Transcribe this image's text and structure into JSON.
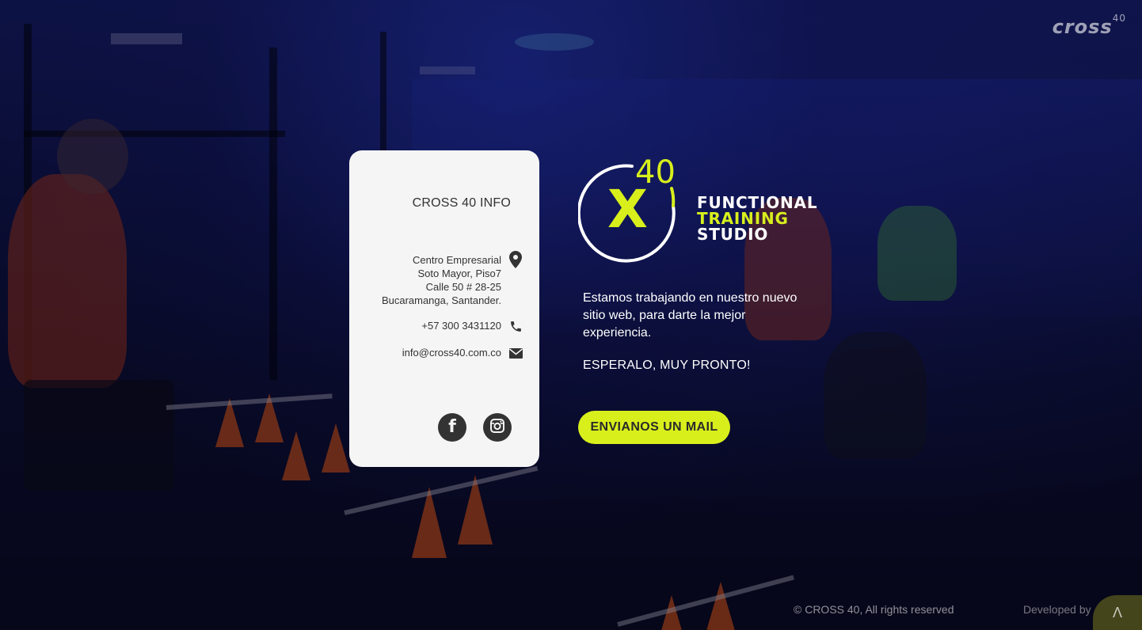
{
  "brand": {
    "name": "cross",
    "superscript": "40"
  },
  "info_card": {
    "title": "CROSS 40 INFO",
    "address": {
      "lines": [
        "Centro Empresarial",
        "Soto Mayor, Piso7",
        "Calle 50 # 28-25",
        "Bucaramanga, Santander."
      ],
      "icon": "location-pin-icon"
    },
    "phone": {
      "text": "+57 300 3431120",
      "icon": "phone-icon"
    },
    "email": {
      "text": "info@cross40.com.co",
      "icon": "mail-icon"
    },
    "social": [
      {
        "name": "facebook",
        "icon": "facebook-icon"
      },
      {
        "name": "instagram",
        "icon": "instagram-icon"
      }
    ]
  },
  "logo": {
    "mark_letter": "X",
    "mark_number": "40",
    "line1": "FUNCTIONAL",
    "line2": "TRAINING",
    "line3": "STUDIO"
  },
  "message": {
    "body": "Estamos trabajando en nuestro nuevo sitio web, para darte la mejor experiencia.",
    "tagline": "ESPERALO, MUY PRONTO!"
  },
  "cta": {
    "label": "ENVIANOS UN MAIL"
  },
  "footer": {
    "copyright": "© CROSS 40, All rights reserved",
    "developed_by": "Developed by",
    "dev_logo_glyph": "Λ"
  },
  "colors": {
    "accent": "#d8ef1c",
    "card_bg": "#f5f5f5",
    "icon_dark": "#333333"
  }
}
